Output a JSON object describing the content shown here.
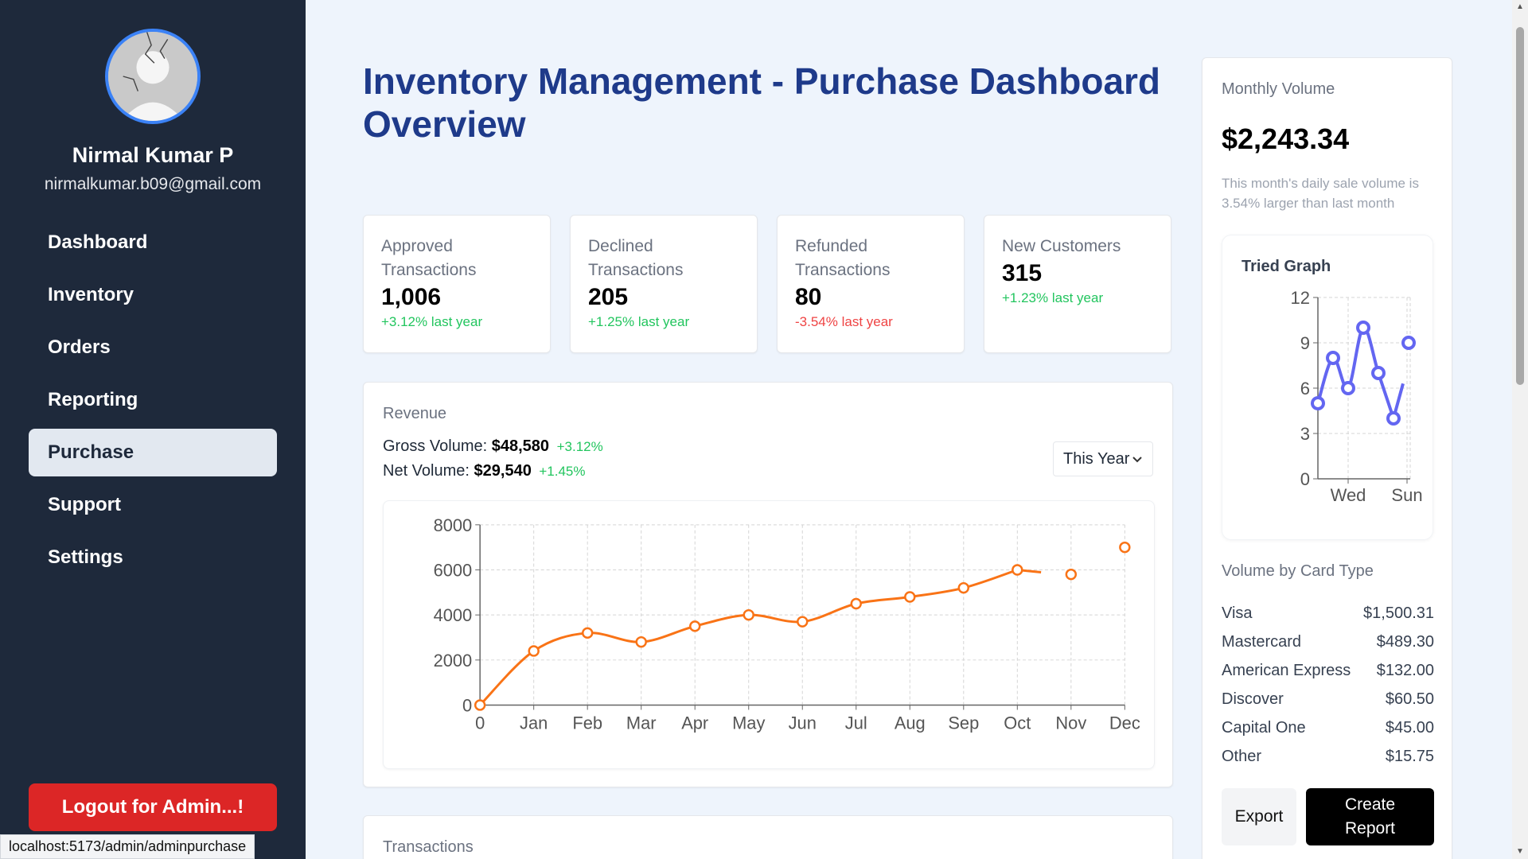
{
  "user": {
    "name": "Nirmal Kumar P",
    "email": "nirmalkumar.b09@gmail.com"
  },
  "nav": [
    {
      "label": "Dashboard",
      "active": false
    },
    {
      "label": "Inventory",
      "active": false
    },
    {
      "label": "Orders",
      "active": false
    },
    {
      "label": "Reporting",
      "active": false
    },
    {
      "label": "Purchase",
      "active": true
    },
    {
      "label": "Support",
      "active": false
    },
    {
      "label": "Settings",
      "active": false
    }
  ],
  "logout_label": "Logout for Admin...!",
  "status_url": "localhost:5173/admin/adminpurchase",
  "page_title": "Inventory Management - Purchase Dashboard Overview",
  "stats": [
    {
      "label": "Approved Transactions",
      "value": "1,006",
      "change": "+3.12% last year",
      "trend": "positive"
    },
    {
      "label": "Declined Transactions",
      "value": "205",
      "change": "+1.25% last year",
      "trend": "positive"
    },
    {
      "label": "Refunded Transactions",
      "value": "80",
      "change": "-3.54% last year",
      "trend": "negative"
    },
    {
      "label": "New Customers",
      "value": "315",
      "change": "+1.23% last year",
      "trend": "positive"
    }
  ],
  "revenue": {
    "label": "Revenue",
    "gross_label": "Gross Volume:",
    "gross_value": "$48,580",
    "gross_change": "+3.12%",
    "net_label": "Net Volume:",
    "net_value": "$29,540",
    "net_change": "+1.45%",
    "period": "This Year"
  },
  "transactions_label": "Transactions",
  "monthly": {
    "label": "Monthly Volume",
    "value": "$2,243.34",
    "description": "This month's daily sale volume is 3.54% larger than last month"
  },
  "tried_graph_title": "Tried Graph",
  "card_type_label": "Volume by Card Type",
  "card_types": [
    {
      "name": "Visa",
      "amount": "$1,500.31"
    },
    {
      "name": "Mastercard",
      "amount": "$489.30"
    },
    {
      "name": "American Express",
      "amount": "$132.00"
    },
    {
      "name": "Discover",
      "amount": "$60.50"
    },
    {
      "name": "Capital One",
      "amount": "$45.00"
    },
    {
      "name": "Other",
      "amount": "$15.75"
    }
  ],
  "export_label": "Export",
  "create_report_label": "Create Report",
  "colors": {
    "sidebar": "#1e293b",
    "title": "#1e3a8a",
    "revenue_line": "#f97316",
    "tried_line": "#6366f1",
    "positive": "#22c55e",
    "negative": "#ef4444"
  },
  "chart_data": [
    {
      "type": "line",
      "categories": [
        "0",
        "Jan",
        "Feb",
        "Mar",
        "Apr",
        "May",
        "Jun",
        "Jul",
        "Aug",
        "Sep",
        "Oct",
        "Nov",
        "Dec"
      ],
      "values": [
        0,
        2400,
        3200,
        2800,
        3500,
        4000,
        3700,
        4500,
        4800,
        5200,
        6000,
        5800,
        7000
      ],
      "ylim": [
        0,
        8000
      ],
      "yticks": [
        0,
        2000,
        4000,
        6000,
        8000
      ],
      "grid": true
    },
    {
      "type": "line",
      "title": "Tried Graph",
      "categories": [
        "Wed",
        "Sun"
      ],
      "values": [
        5,
        8,
        6,
        10,
        7,
        4,
        9
      ],
      "ylim": [
        0,
        12
      ],
      "yticks": [
        0,
        3,
        6,
        9,
        12
      ],
      "grid": true
    }
  ]
}
